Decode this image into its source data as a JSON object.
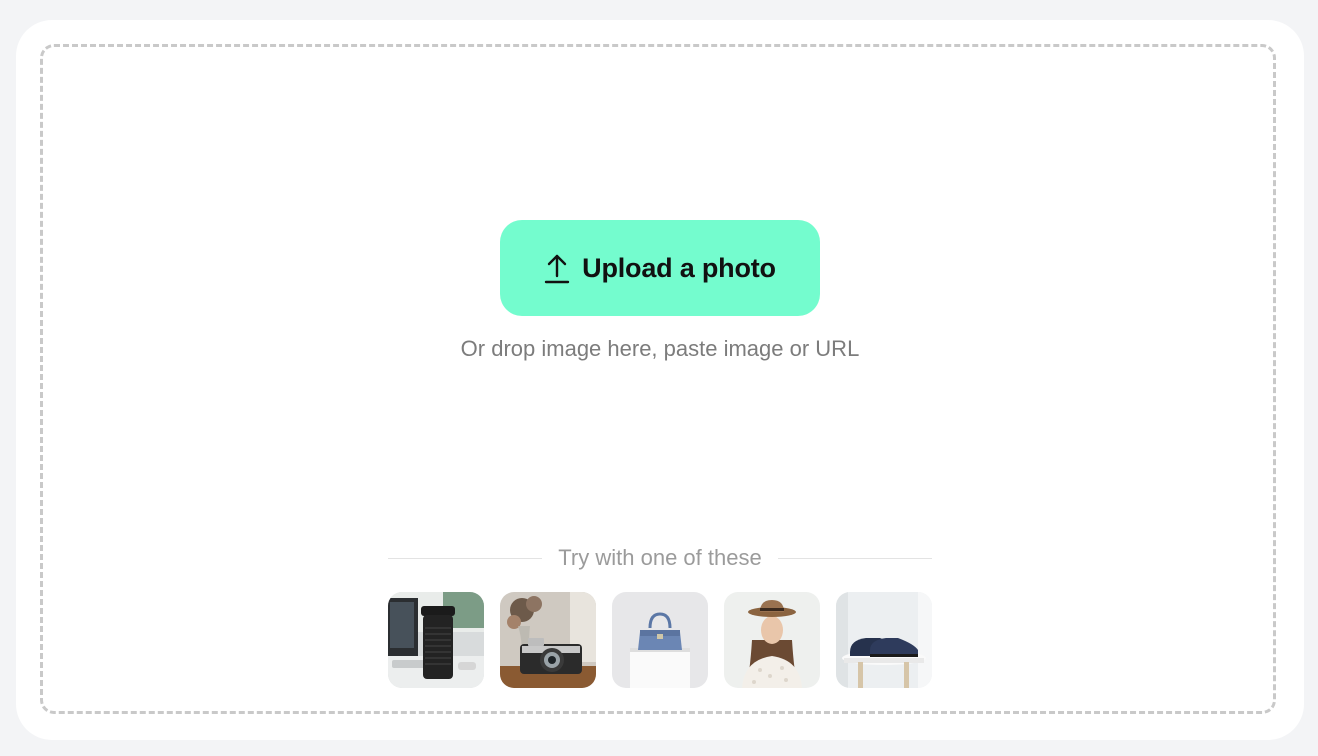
{
  "upload": {
    "button_label": "Upload a photo",
    "icon": "upload-arrow-icon",
    "hint": "Or drop image here, paste image or URL"
  },
  "samples": {
    "heading": "Try with one of these",
    "items": [
      {
        "subject": "black travel mug"
      },
      {
        "subject": "vintage camera"
      },
      {
        "subject": "blue handbag"
      },
      {
        "subject": "woman in straw hat"
      },
      {
        "subject": "navy leather shoes"
      }
    ]
  },
  "colors": {
    "page_background": "#f3f4f6",
    "card_background": "#ffffff",
    "button_accent": "#74fcce",
    "dashed_border": "#c9c9c9",
    "hint_text": "#7c7c7c"
  }
}
